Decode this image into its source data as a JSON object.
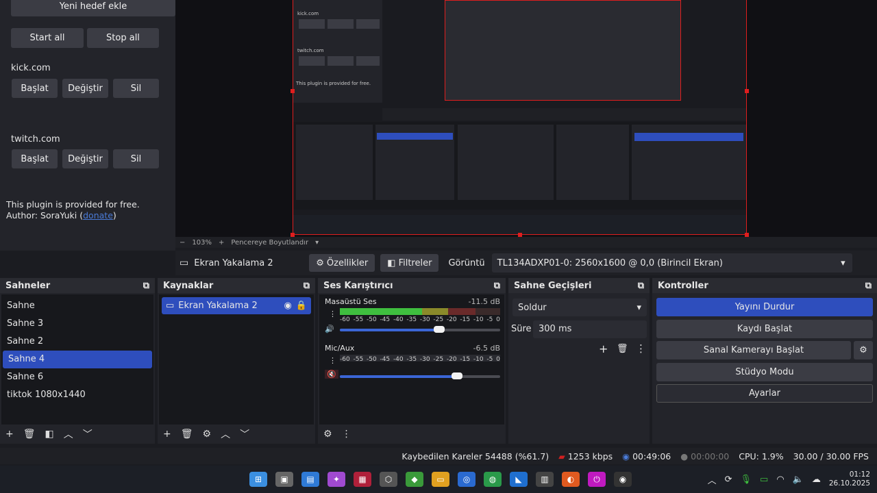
{
  "plugin": {
    "add_target": "Yeni hedef ekle",
    "start_all": "Start all",
    "stop_all": "Stop all",
    "services": [
      {
        "name": "kick.com",
        "start": "Başlat",
        "edit": "Değiştir",
        "delete": "Sil"
      },
      {
        "name": "twitch.com",
        "start": "Başlat",
        "edit": "Değiştir",
        "delete": "Sil"
      }
    ],
    "free_line": "This plugin is provided for free.",
    "author_prefix": "Author: SoraYuki (",
    "donate": "donate",
    "author_suffix": ")"
  },
  "preview": {
    "zoom": "103%",
    "fit_label": "Pencereye Boyutlandır"
  },
  "source_bar": {
    "source_name": "Ekran Yakalama 2",
    "properties": "Özellikler",
    "filters": "Filtreler",
    "display_label": "Görüntü",
    "display_value": "TL134ADXP01-0: 2560x1600 @ 0,0 (Birincil Ekran)"
  },
  "scenes": {
    "title": "Sahneler",
    "items": [
      "Sahne",
      "Sahne 3",
      "Sahne 2",
      "Sahne 4",
      "Sahne 6",
      "tiktok 1080x1440"
    ],
    "selected_index": 3
  },
  "sources": {
    "title": "Kaynaklar",
    "items": [
      "Ekran Yakalama 2"
    ]
  },
  "mixer": {
    "title": "Ses Karıştırıcı",
    "ticks": [
      "-60",
      "-55",
      "-50",
      "-45",
      "-40",
      "-35",
      "-30",
      "-25",
      "-20",
      "-15",
      "-10",
      "-5",
      "0"
    ],
    "channels": [
      {
        "name": "Masaüstü Ses",
        "db": "-11.5 dB",
        "volume": 0.62,
        "muted": false
      },
      {
        "name": "Mic/Aux",
        "db": "-6.5 dB",
        "volume": 0.73,
        "muted": true
      }
    ]
  },
  "transitions": {
    "title": "Sahne Geçişleri",
    "type": "Soldur",
    "duration_label": "Süre",
    "duration_value": "300 ms"
  },
  "controls": {
    "title": "Kontroller",
    "stop_stream": "Yayını Durdur",
    "start_record": "Kaydı Başlat",
    "virtual_cam": "Sanal Kamerayı Başlat",
    "studio_mode": "Stüdyo Modu",
    "settings": "Ayarlar"
  },
  "status": {
    "dropped": "Kaybedilen Kareler 54488 (%61.7)",
    "bitrate": "1253 kbps",
    "stream_time": "00:49:06",
    "record_time": "00:00:00",
    "cpu": "CPU: 1.9%",
    "fps": "30.00 / 30.00 FPS"
  },
  "clock": {
    "time": "01:12",
    "date": "26.10.2025"
  },
  "colors": {
    "accent": "#2e4ebd",
    "record_red": "#e01e1e"
  }
}
